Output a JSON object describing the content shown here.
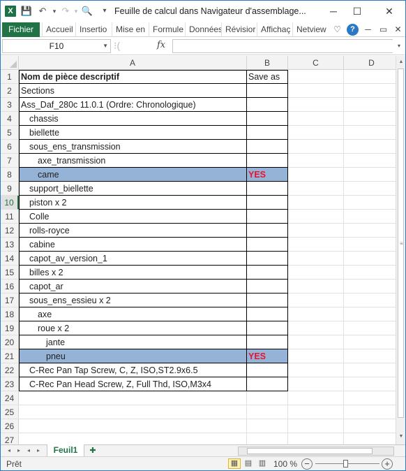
{
  "window": {
    "title": "Feuille de calcul dans Navigateur d'assemblage...",
    "minimize_glyph": "─",
    "maximize_glyph": "☐",
    "close_glyph": "✕"
  },
  "app_icon": {
    "letter": "X",
    "icon": "excel-icon"
  },
  "qat": {
    "save_icon": "💾",
    "undo_icon": "↶",
    "redo_icon": "↷",
    "preview_icon": "🔍",
    "customize_icon": "▾"
  },
  "ribbon": {
    "file_label": "Fichier",
    "tabs": [
      "Accueil",
      "Insertio",
      "Mise en",
      "Formule",
      "Données",
      "Révisior",
      "Affichaç",
      "Netview"
    ],
    "icons": {
      "collapse": "♡",
      "help": "?",
      "restore": "▭",
      "close": "✕"
    }
  },
  "formula_bar": {
    "name_box": "F10",
    "fx_label": "fx",
    "formula_value": ""
  },
  "columns": [
    "A",
    "B",
    "C",
    "D"
  ],
  "rows": [
    {
      "n": "1",
      "a": "Nom de pièce descriptif",
      "b": "Save as",
      "indent": 0
    },
    {
      "n": "2",
      "a": "Sections",
      "b": "",
      "indent": 0
    },
    {
      "n": "3",
      "a": "Ass_Daf_280c 11.0.1 (Ordre: Chronologique)",
      "b": "",
      "indent": 0
    },
    {
      "n": "4",
      "a": "chassis",
      "b": "",
      "indent": 1
    },
    {
      "n": "5",
      "a": "biellette",
      "b": "",
      "indent": 1
    },
    {
      "n": "6",
      "a": "sous_ens_transmission",
      "b": "",
      "indent": 1
    },
    {
      "n": "7",
      "a": "axe_transmission",
      "b": "",
      "indent": 2
    },
    {
      "n": "8",
      "a": "came",
      "b": "YES",
      "indent": 2
    },
    {
      "n": "9",
      "a": "support_biellette",
      "b": "",
      "indent": 1
    },
    {
      "n": "10",
      "a": "piston x 2",
      "b": "",
      "indent": 1
    },
    {
      "n": "11",
      "a": "Colle",
      "b": "",
      "indent": 1
    },
    {
      "n": "12",
      "a": "rolls-royce",
      "b": "",
      "indent": 1
    },
    {
      "n": "13",
      "a": "cabine",
      "b": "",
      "indent": 1
    },
    {
      "n": "14",
      "a": "capot_av_version_1",
      "b": "",
      "indent": 1
    },
    {
      "n": "15",
      "a": "billes x 2",
      "b": "",
      "indent": 1
    },
    {
      "n": "16",
      "a": "capot_ar",
      "b": "",
      "indent": 1
    },
    {
      "n": "17",
      "a": "sous_ens_essieu x 2",
      "b": "",
      "indent": 1
    },
    {
      "n": "18",
      "a": "axe",
      "b": "",
      "indent": 2
    },
    {
      "n": "19",
      "a": "roue x 2",
      "b": "",
      "indent": 2
    },
    {
      "n": "20",
      "a": "jante",
      "b": "",
      "indent": 3
    },
    {
      "n": "21",
      "a": "pneu",
      "b": "YES",
      "indent": 3
    },
    {
      "n": "22",
      "a": "C-Rec Pan Tap Screw, C, Z, ISO,ST2.9x6.5",
      "b": "",
      "indent": 1
    },
    {
      "n": "23",
      "a": "C-Rec Pan Head Screw, Z, Full Thd, ISO,M3x4",
      "b": "",
      "indent": 1
    },
    {
      "n": "24",
      "a": "",
      "b": "",
      "indent": 0
    },
    {
      "n": "25",
      "a": "",
      "b": "",
      "indent": 0
    },
    {
      "n": "26",
      "a": "",
      "b": "",
      "indent": 0
    },
    {
      "n": "27",
      "a": "",
      "b": "",
      "indent": 0
    }
  ],
  "highlight_color": "#95b3d7",
  "yes_color": "#e6142d",
  "selected_row": "10",
  "sheet_tabs": {
    "active": "Feuil1",
    "nav": [
      "◂",
      "▸",
      "◂",
      "▸"
    ]
  },
  "status": {
    "ready": "Prêt",
    "zoom": "100 %",
    "zoom_minus": "−",
    "zoom_plus": "+"
  }
}
